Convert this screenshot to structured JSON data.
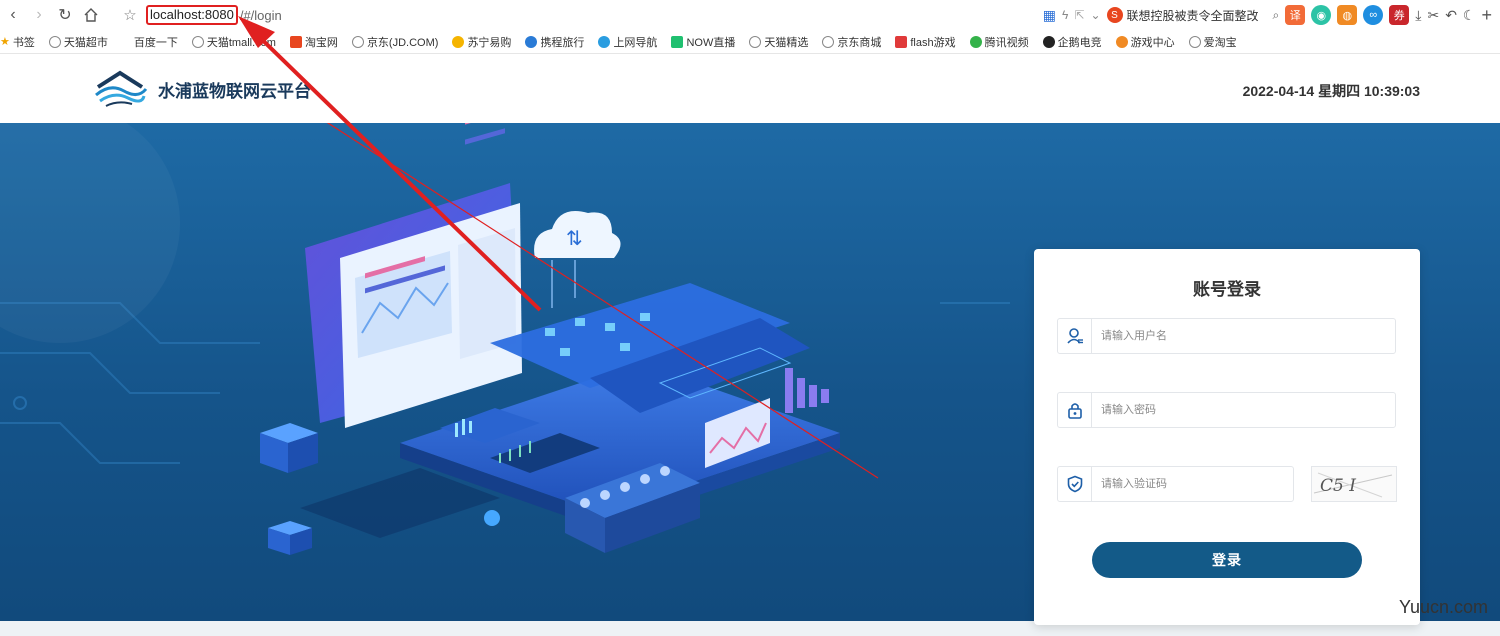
{
  "browser": {
    "url_host": "localhost:8080",
    "url_path": "/#/login",
    "news_text": "联想控股被责令全面整改"
  },
  "bookmarks": [
    {
      "label": "书签",
      "icon": "star-icon"
    },
    {
      "label": "天猫超市",
      "icon": "globe-icon"
    },
    {
      "label": "百度一下",
      "icon": "none"
    },
    {
      "label": "天猫tmall.com",
      "icon": "globe-icon"
    },
    {
      "label": "淘宝网",
      "icon": "taobao-icon"
    },
    {
      "label": "京东(JD.COM)",
      "icon": "globe-icon"
    },
    {
      "label": "苏宁易购",
      "icon": "suning-icon"
    },
    {
      "label": "携程旅行",
      "icon": "ctrip-icon"
    },
    {
      "label": "上网导航",
      "icon": "nav-icon"
    },
    {
      "label": "NOW直播",
      "icon": "now-icon"
    },
    {
      "label": "天猫精选",
      "icon": "globe-icon"
    },
    {
      "label": "京东商城",
      "icon": "globe-icon"
    },
    {
      "label": "flash游戏",
      "icon": "flash-icon"
    },
    {
      "label": "腾讯视频",
      "icon": "video-icon"
    },
    {
      "label": "企鹅电竞",
      "icon": "penguin-icon"
    },
    {
      "label": "游戏中心",
      "icon": "game-icon"
    },
    {
      "label": "爱淘宝",
      "icon": "globe-icon"
    }
  ],
  "header": {
    "title": "水浦蓝物联网云平台",
    "datetime": "2022-04-14 星期四 10:39:03"
  },
  "login": {
    "title": "账号登录",
    "username_placeholder": "请输入用户名",
    "password_placeholder": "请输入密码",
    "code_placeholder": "请输入验证码",
    "captcha_text": "C5 I",
    "submit_label": "登录"
  },
  "watermark": "Yuucn.com",
  "colors": {
    "hero_blue": "#15548a",
    "button_blue": "#135a88",
    "highlight_red": "#e02020"
  }
}
